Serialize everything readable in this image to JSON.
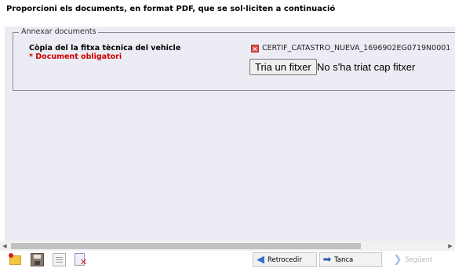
{
  "header": {
    "instruction": "Proporcioni els documents, en format PDF, que se sol·liciten a continuació"
  },
  "attach": {
    "legend": "Annexar documents",
    "document_label": "Còpia del la fitxa tècnica del vehicle",
    "required_text": "* Document obligatori",
    "file_name": "CERTIF_CATASTRO_NUEVA_1696902EG0719N0001",
    "file_button": "Tria un fitxer",
    "file_status": "No s'ha triat cap fitxer"
  },
  "scrollbar": {
    "left_arrow": "◀",
    "right_arrow": "▶"
  },
  "toolbar": {
    "icons": [
      "open-folder-icon",
      "save-icon",
      "document-icon",
      "delete-document-icon"
    ],
    "back_label": "Retrocedir",
    "close_label": "Tanca",
    "next_label": "Següent"
  },
  "colors": {
    "panel_background": "#ecedf4",
    "required_red": "#d00000",
    "accent_blue": "#2f6fd0"
  }
}
